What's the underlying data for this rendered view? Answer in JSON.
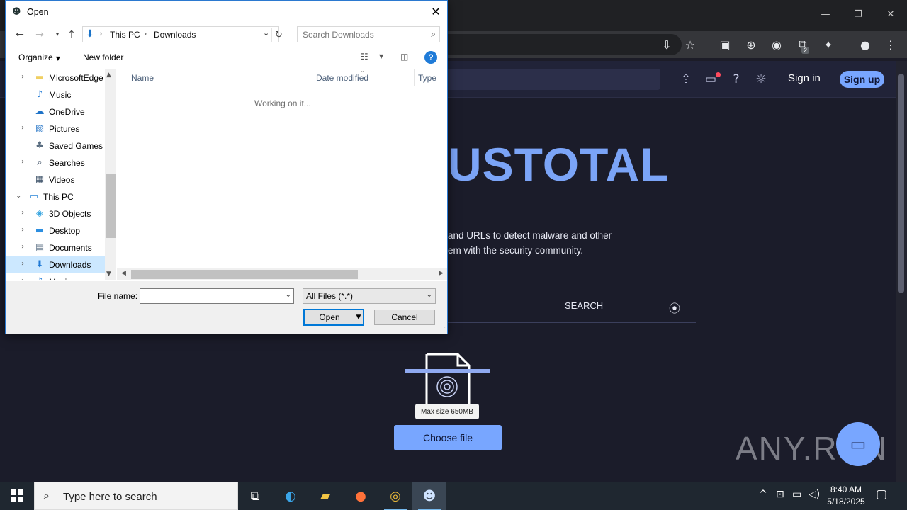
{
  "browser": {
    "minimize_icon": "—",
    "restore_icon": "❐",
    "close_icon": "✕",
    "extensions_badge": "2"
  },
  "site": {
    "brand_text": "USTOTAL",
    "tagline_line1": "and URLs to detect malware and other",
    "tagline_line2": "em with the security community.",
    "signin": "Sign in",
    "signup": "Sign up",
    "tab_search": "SEARCH",
    "tooltip": "Max size 650MB",
    "choose_file": "Choose file",
    "watermark": "ANY.RUN"
  },
  "dialog": {
    "title": "Open",
    "breadcrumb": [
      "This PC",
      "Downloads"
    ],
    "search_placeholder": "Search Downloads",
    "organize": "Organize",
    "new_folder": "New folder",
    "nav_items": [
      {
        "label": "MicrosoftEdge",
        "icon": "folder-icon",
        "expandable": true,
        "selected": false
      },
      {
        "label": "Music",
        "icon": "music-icon",
        "expandable": false,
        "selected": false
      },
      {
        "label": "OneDrive",
        "icon": "cloud-icon",
        "expandable": false,
        "selected": false
      },
      {
        "label": "Pictures",
        "icon": "pictures-icon",
        "expandable": true,
        "selected": false
      },
      {
        "label": "Saved Games",
        "icon": "saved-games-icon",
        "expandable": false,
        "selected": false
      },
      {
        "label": "Searches",
        "icon": "search-folder-icon",
        "expandable": true,
        "selected": false
      },
      {
        "label": "Videos",
        "icon": "videos-icon",
        "expandable": false,
        "selected": false
      },
      {
        "label": "This PC",
        "icon": "computer-icon",
        "expandable": true,
        "selected": false
      },
      {
        "label": "3D Objects",
        "icon": "3d-objects-icon",
        "expandable": true,
        "selected": false
      },
      {
        "label": "Desktop",
        "icon": "desktop-icon",
        "expandable": true,
        "selected": false
      },
      {
        "label": "Documents",
        "icon": "documents-icon",
        "expandable": true,
        "selected": false
      },
      {
        "label": "Downloads",
        "icon": "downloads-icon",
        "expandable": true,
        "selected": true
      },
      {
        "label": "Music",
        "icon": "music-icon",
        "expandable": true,
        "selected": false
      }
    ],
    "columns": [
      "Name",
      "Date modified",
      "Type"
    ],
    "status": "Working on it...",
    "file_name_label": "File name:",
    "file_name_value": "",
    "file_filter": "All Files (*.*)",
    "open_label": "Open",
    "cancel_label": "Cancel"
  },
  "taskbar": {
    "search_text": "Type here to search",
    "time": "8:40 AM",
    "date": "5/18/2025"
  },
  "colors": {
    "accent": "#0078d7",
    "site_accent": "#78a6ff",
    "selection": "#cce8ff"
  }
}
